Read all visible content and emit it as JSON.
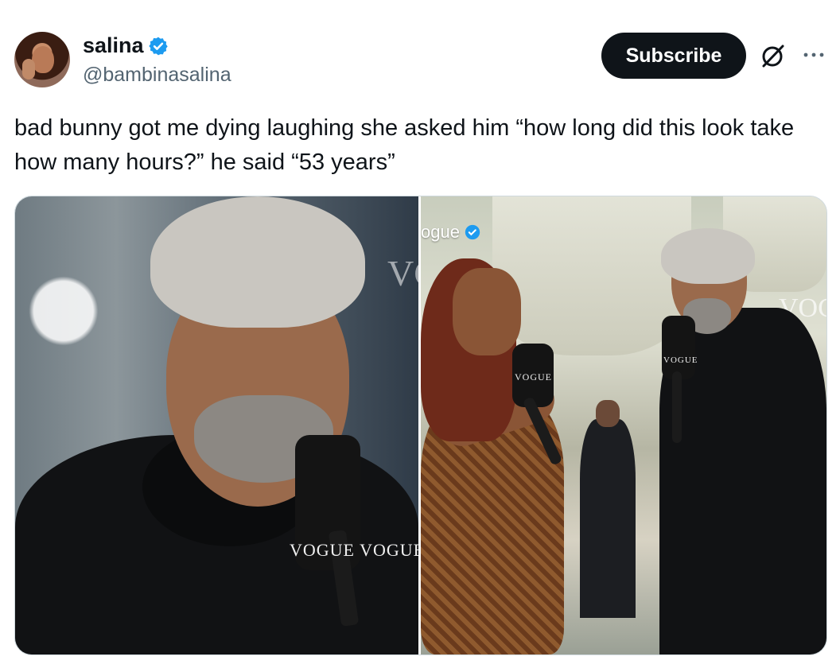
{
  "author": {
    "display_name": "salina",
    "handle": "@bambinasalina",
    "verified": true
  },
  "actions": {
    "subscribe_label": "Subscribe",
    "grok_icon": "grok-slash-icon",
    "more_icon": "ellipsis-icon"
  },
  "tweet": {
    "text": "bad bunny got me dying laughing she asked him “how long did this look take how many hours?” he said “53 years”"
  },
  "media": {
    "photo_left": {
      "mic_label": "VOGUE VOGUE",
      "wall_text": "VC"
    },
    "photo_right": {
      "overlay_account": "ogue",
      "mic_label_woman": "VOGUE",
      "mic_label_man": "VOGUE",
      "wall_text": "VOG"
    }
  },
  "colors": {
    "text_primary": "#0f1419",
    "text_secondary": "#536471",
    "verified_blue": "#1d9bf0",
    "subscribe_bg": "#0f1419"
  }
}
